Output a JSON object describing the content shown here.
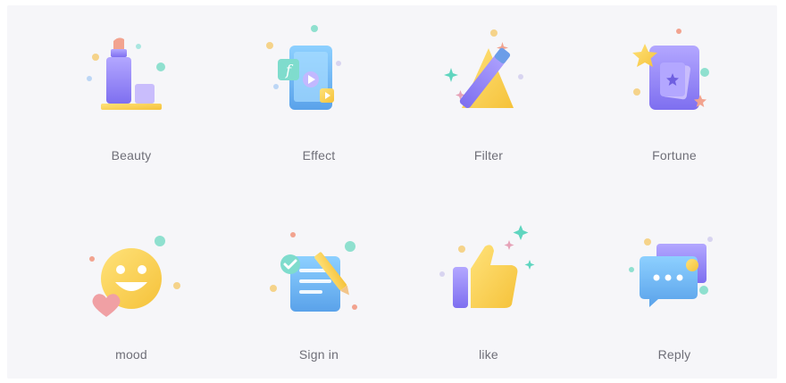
{
  "items": [
    {
      "label": "Beauty",
      "icon": "lipstick-icon"
    },
    {
      "label": "Effect",
      "icon": "tablet-effect-icon"
    },
    {
      "label": "Filter",
      "icon": "magic-wand-icon"
    },
    {
      "label": "Fortune",
      "icon": "tarot-card-icon"
    },
    {
      "label": "mood",
      "icon": "smiley-heart-icon"
    },
    {
      "label": "Sign in",
      "icon": "clipboard-pen-icon"
    },
    {
      "label": "like",
      "icon": "thumbs-up-icon"
    },
    {
      "label": "Reply",
      "icon": "chat-bubble-icon"
    }
  ],
  "colors": {
    "purple": "#8f86f2",
    "yellow": "#f7cc47",
    "blue": "#69b6ee",
    "teal": "#7fdccd",
    "pink": "#f09a9a",
    "label": "#6f6f78",
    "background": "#f6f6f9"
  }
}
